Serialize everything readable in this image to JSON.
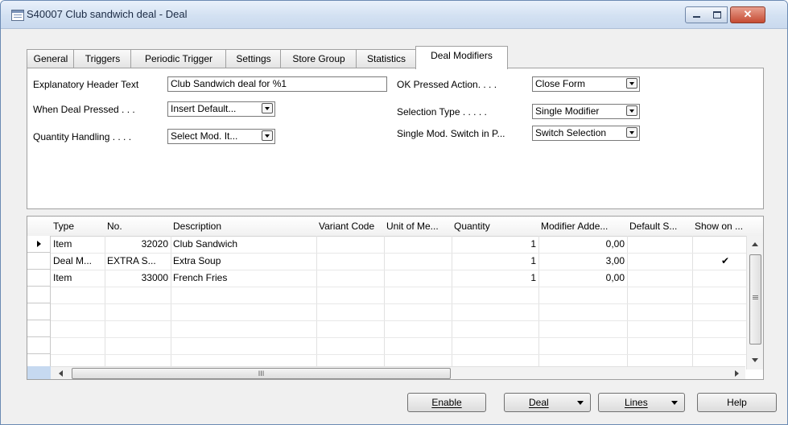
{
  "window": {
    "title": "S40007 Club sandwich deal - Deal"
  },
  "tabs": [
    "General",
    "Triggers",
    "Periodic Trigger",
    "Settings",
    "Store Group",
    "Statistics",
    "Deal Modifiers"
  ],
  "active_tab": "Deal Modifiers",
  "form": {
    "explanatory_header": {
      "label": "Explanatory Header Text",
      "value": "Club Sandwich deal for %1"
    },
    "when_deal_pressed": {
      "label": "When Deal Pressed . . .",
      "value": "Insert Default..."
    },
    "quantity_handling": {
      "label": "Quantity Handling . . . .",
      "value": "Select Mod. It..."
    },
    "ok_pressed_action": {
      "label": "OK Pressed Action. . . .",
      "value": "Close Form"
    },
    "selection_type": {
      "label": "Selection Type . . . . .",
      "value": "Single Modifier"
    },
    "single_mod_switch": {
      "label": "Single Mod. Switch in P...",
      "value": "Switch Selection"
    }
  },
  "grid": {
    "columns": [
      "Type",
      "No.",
      "Description",
      "Variant Code",
      "Unit of Me...",
      "Quantity",
      "Modifier Adde...",
      "Default S...",
      "Show on ..."
    ],
    "rows": [
      {
        "type": "Item",
        "no": "32020",
        "description": "Club Sandwich",
        "variant": "",
        "unit": "",
        "quantity": "1",
        "modifier": "0,00",
        "default": "",
        "show": ""
      },
      {
        "type": "Deal M...",
        "no": "EXTRA S...",
        "description": "Extra Soup",
        "variant": "",
        "unit": "",
        "quantity": "1",
        "modifier": "3,00",
        "default": "",
        "show": "✔"
      },
      {
        "type": "Item",
        "no": "33000",
        "description": "French Fries",
        "variant": "",
        "unit": "",
        "quantity": "1",
        "modifier": "0,00",
        "default": "",
        "show": ""
      }
    ],
    "scroll_marker": "III"
  },
  "buttons": {
    "enable": "Enable",
    "deal": "Deal",
    "lines": "Lines",
    "help": "Help"
  }
}
